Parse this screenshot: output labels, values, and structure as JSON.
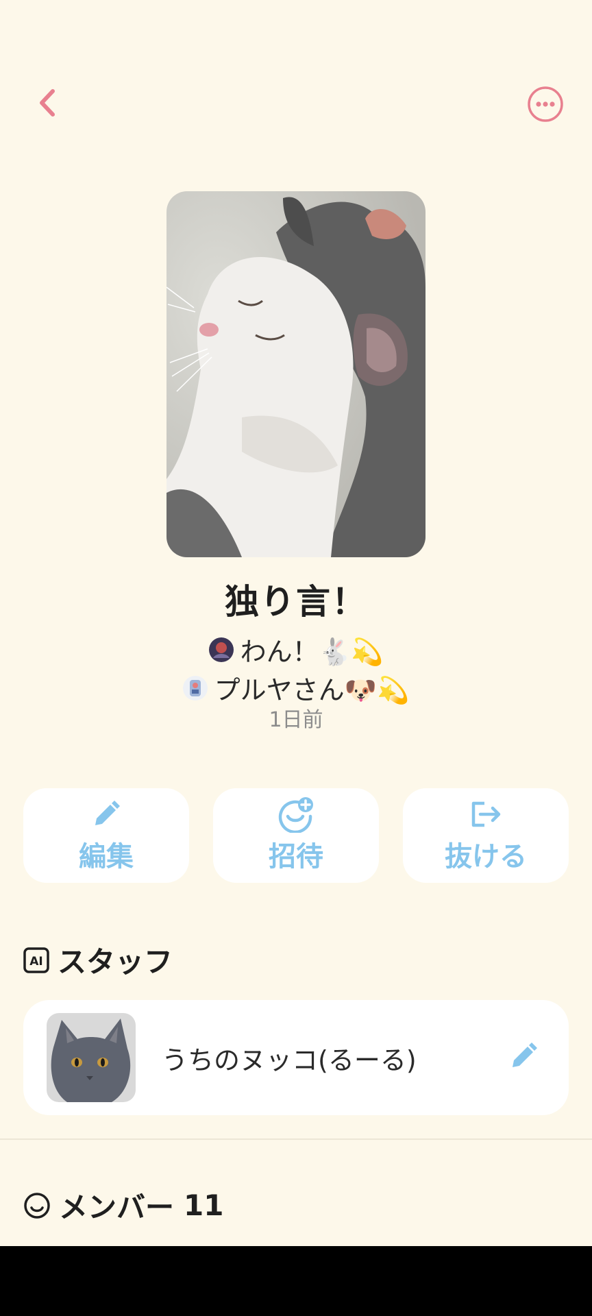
{
  "header": {
    "back_icon": "chevron-left-icon",
    "more_icon": "more-horizontal-icon",
    "accent_color": "#e8808f"
  },
  "room": {
    "title": "独り言！",
    "creators": [
      {
        "name": "わん！🐇💫"
      },
      {
        "name": "プルヤさん🐶💫"
      }
    ],
    "time": "1日前"
  },
  "actions": {
    "edit_label": "編集",
    "invite_label": "招待",
    "leave_label": "抜ける",
    "color": "#86c5ec"
  },
  "staff": {
    "heading": "スタッフ",
    "icon": "ai-badge-icon",
    "items": [
      {
        "name": "うちのヌッコ(るーる)",
        "edit_icon": "pencil-icon"
      }
    ]
  },
  "members": {
    "heading": "メンバー",
    "count": "11",
    "icon": "smiley-icon"
  }
}
